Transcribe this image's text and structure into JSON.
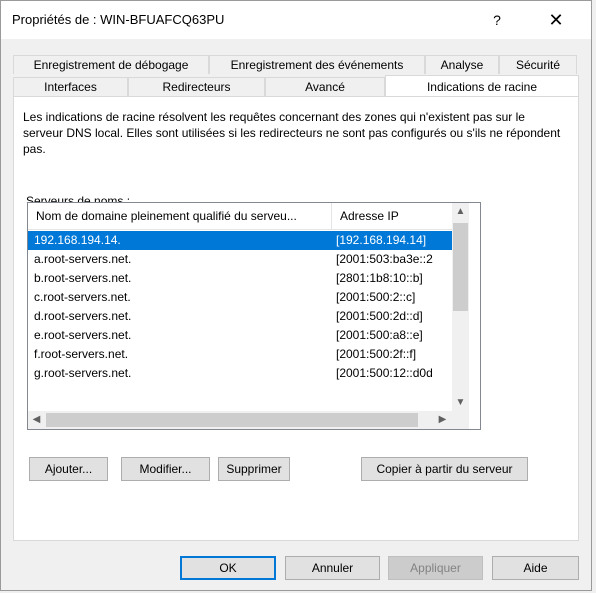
{
  "window": {
    "title": "Propriétés de : WIN-BFUAFCQ63PU",
    "help_glyph": "?",
    "close_glyph": "✕"
  },
  "tabs": {
    "row1": [
      "Enregistrement de débogage",
      "Enregistrement des événements",
      "Analyse",
      "Sécurité"
    ],
    "row2": [
      "Interfaces",
      "Redirecteurs",
      "Avancé",
      "Indications de racine"
    ],
    "active": "Indications de racine"
  },
  "root_hints": {
    "description": "Les indications de racine résolvent les requêtes concernant des zones qui n'existent pas sur le serveur DNS local. Elles sont utilisées si les redirecteurs ne sont pas configurés ou s'ils ne répondent pas.",
    "list_label": "Serveurs de noms :",
    "columns": [
      "Nom de domaine pleinement qualifié du serveu...",
      "Adresse IP"
    ],
    "rows": [
      {
        "name": "192.168.194.14.",
        "ip": "[192.168.194.14]",
        "selected": true
      },
      {
        "name": "a.root-servers.net.",
        "ip": "[2001:503:ba3e::2"
      },
      {
        "name": "b.root-servers.net.",
        "ip": "[2801:1b8:10::b]"
      },
      {
        "name": "c.root-servers.net.",
        "ip": "[2001:500:2::c]"
      },
      {
        "name": "d.root-servers.net.",
        "ip": "[2001:500:2d::d]"
      },
      {
        "name": "e.root-servers.net.",
        "ip": "[2001:500:a8::e]"
      },
      {
        "name": "f.root-servers.net.",
        "ip": "[2001:500:2f::f]"
      },
      {
        "name": "g.root-servers.net.",
        "ip": "[2001:500:12::d0d"
      }
    ],
    "buttons": {
      "add": "Ajouter...",
      "modify": "Modifier...",
      "delete": "Supprimer",
      "copy": "Copier à partir du serveur"
    }
  },
  "footer": {
    "ok": "OK",
    "cancel": "Annuler",
    "apply": "Appliquer",
    "help": "Aide"
  },
  "colors": {
    "selection": "#0078d7",
    "default_button_border": "#0078d7"
  }
}
